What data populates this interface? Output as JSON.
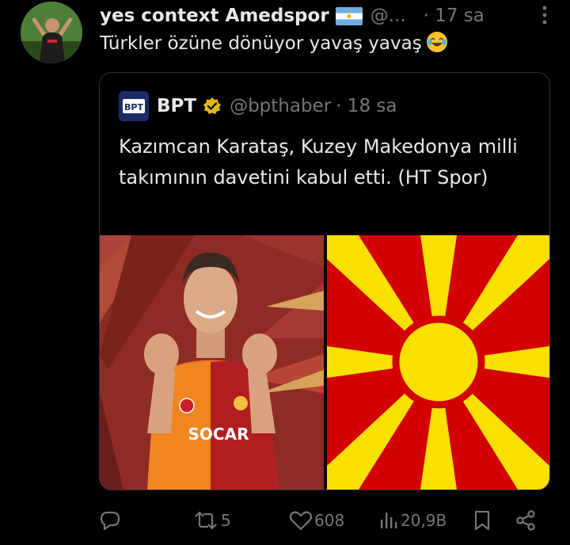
{
  "tweet": {
    "author_name": "yes context Amedspor",
    "handle": "@...",
    "time": "· 17 sa",
    "text": "Türkler özüne dönüyor yavaş yavaş",
    "more": "⋮",
    "emoji": "face-with-tears-of-joy"
  },
  "quoted": {
    "author_name": "BPT",
    "logo_text": "BPT",
    "handle": "@bpthaber",
    "time": "· 18 sa",
    "text": "Kazımcan Karataş, Kuzey Makedonya milli takımının davetini kabul etti. (HT Spor)",
    "media": {
      "left_image": "player-in-galatasaray-jersey",
      "jersey_text": "SOCAR",
      "right_image": "north-macedonia-flag",
      "flag_red": "#d20000",
      "flag_yellow": "#f8e000"
    }
  },
  "actions": {
    "reply_count": "",
    "retweet_count": "5",
    "like_count": "608",
    "views_count": "20,9B"
  },
  "colors": {
    "background": "#000000",
    "text": "#e7e9ea",
    "muted": "#71767b",
    "border": "#2f3336",
    "verified": "#e2b719"
  }
}
